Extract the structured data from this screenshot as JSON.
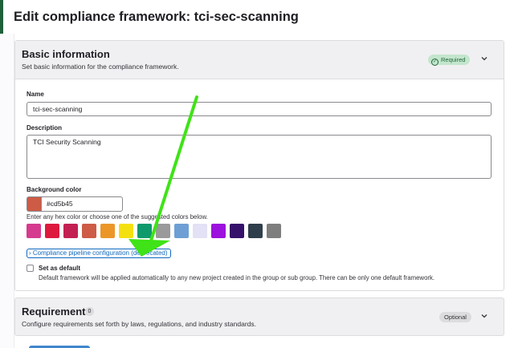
{
  "page": {
    "title": "Edit compliance framework: tci-sec-scanning"
  },
  "basic_info": {
    "title": "Basic information",
    "subtitle": "Set basic information for the compliance framework.",
    "badge": "Required",
    "name_label": "Name",
    "name_value": "tci-sec-scanning",
    "description_label": "Description",
    "description_value": "TCI Security Scanning",
    "bg_color_label": "Background color",
    "bg_color_value": "#cd5b45",
    "color_hint": "Enter any hex color or choose one of the suggested colors below.",
    "suggested_colors": [
      "#d63a8f",
      "#dd1a3e",
      "#c41f52",
      "#cd5b45",
      "#ec9628",
      "#f5e00f",
      "#109a6b",
      "#9a9a9a",
      "#6e9fd4",
      "#e2e1f5",
      "#9c11dd",
      "#35116a",
      "#2f3e4b",
      "#7e7e7e"
    ],
    "pipeline_link": "Compliance pipeline configuration (deprecated)",
    "default_label": "Set as default",
    "default_help": "Default framework will be applied automatically to any new project created in the group or sub group. There can be only one default framework."
  },
  "requirements": {
    "title": "Requirements",
    "count": "0",
    "subtitle": "Configure requirements set forth by laws, regulations, and industry standards.",
    "badge": "Optional"
  },
  "annotation_color": "#3fe317"
}
